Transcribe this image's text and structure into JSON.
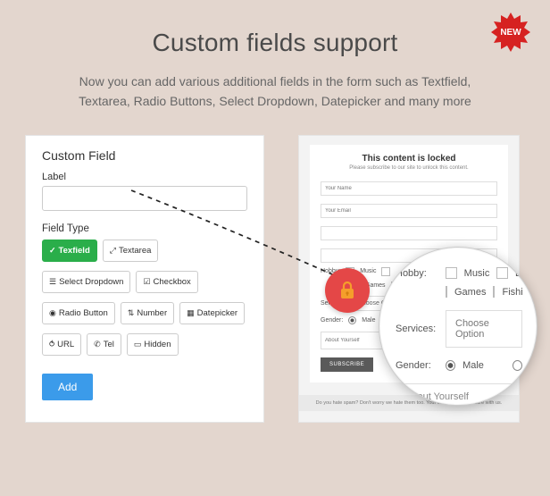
{
  "badge": {
    "label": "NEW"
  },
  "title": "Custom fields support",
  "description": "Now you can add various additional fields in the form such as Textfield, Textarea, Radio Buttons, Select Dropdown, Datepicker and many more",
  "left_panel": {
    "heading": "Custom Field",
    "label_text": "Label",
    "field_type_heading": "Field Type",
    "buttons": {
      "texfield": "Texfield",
      "textarea": "Textarea",
      "select_dropdown": "Select Dropdown",
      "checkbox": "Checkbox",
      "radio_button": "Radio Button",
      "number": "Number",
      "datepicker": "Datepicker",
      "url": "URL",
      "tel": "Tel",
      "hidden": "Hidden"
    },
    "add_button": "Add"
  },
  "right_panel": {
    "locked_title": "This content is locked",
    "locked_sub": "Please subscribe to our site to unlock this content.",
    "placeholders": {
      "name": "Your Name",
      "email": "Your Email"
    },
    "hobby_label": "Hobby:",
    "hobby_options": {
      "music": "Music",
      "games": "Games",
      "fishing": "Fishi"
    },
    "services_label": "Services:",
    "choose_option": "Choose Option",
    "gender_label": "Gender:",
    "gender_male": "Male",
    "about_placeholder": "About Yourself",
    "subscribe": "SUBSCRIBE",
    "spam_note": "Do you hate spam? Don't worry we hate them too. Your email is 100% secure with us."
  },
  "lens": {
    "hobby_label": "Hobby:",
    "hobby_options": {
      "music": "Music",
      "d": "D",
      "games": "Games",
      "fishing": "Fishi"
    },
    "services_label": "Services:",
    "choose_option": "Choose Option",
    "gender_label": "Gender:",
    "gender_male": "Male",
    "about_placeholder": "About Yourself"
  }
}
